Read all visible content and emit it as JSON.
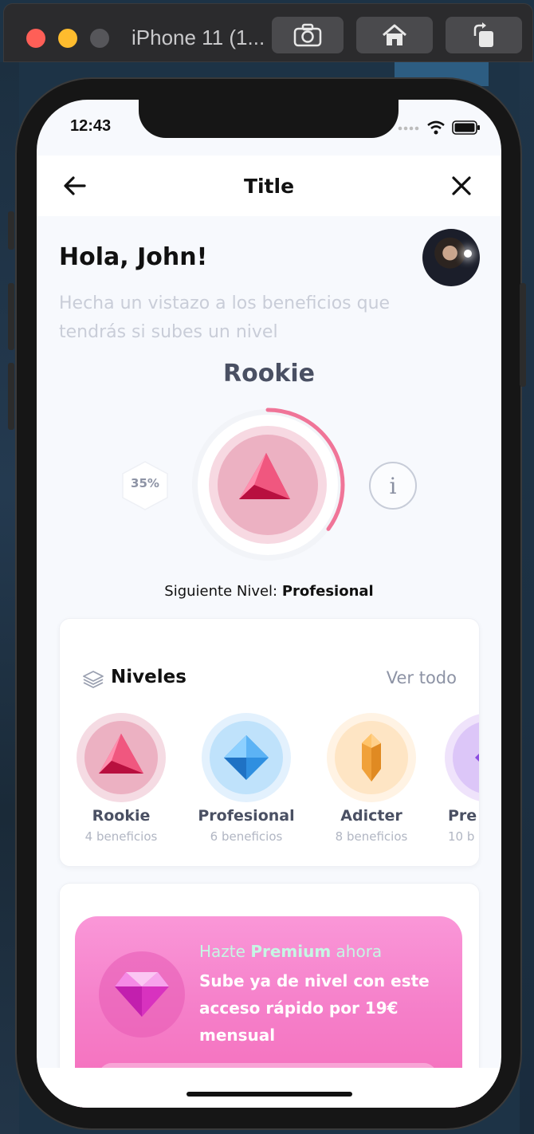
{
  "simulator": {
    "title": "iPhone 11 (1...",
    "buttons": [
      "screenshot",
      "home",
      "rotate"
    ]
  },
  "status": {
    "time": "12:43"
  },
  "nav": {
    "title": "Title"
  },
  "greeting": "Hola, John!",
  "subtitle": "Hecha un vistazo a los beneficios que tendrás si subes un nivel",
  "level": {
    "current": "Rookie",
    "progress_label": "35%",
    "progress": 0.35,
    "next_prefix": "Siguiente Nivel:",
    "next_name": "Profesional",
    "info_symbol": "i"
  },
  "levels_section": {
    "title": "Niveles",
    "see_all": "Ver todo",
    "items": [
      {
        "name": "Rookie",
        "benefits": "4 beneficios",
        "icon": "triangle-gem-icon",
        "color": "#e81e5a"
      },
      {
        "name": "Profesional",
        "benefits": "6 beneficios",
        "icon": "diamond-gem-icon",
        "color": "#2f8fe0"
      },
      {
        "name": "Adicter",
        "benefits": "8 beneficios",
        "icon": "crystal-gem-icon",
        "color": "#f0a13a"
      },
      {
        "name": "Pre",
        "benefits": "10 b",
        "icon": "purple-gem-icon",
        "color": "#8a4be0"
      }
    ]
  },
  "premium": {
    "prefix": "Hazte",
    "highlight": "Premium",
    "suffix": "ahora",
    "description": "Sube ya de nivel con este acceso rápido por 19€ mensual"
  },
  "colors": {
    "accent_pink": "#f07598",
    "premium_gradient_top": "#fa97d8",
    "premium_gradient_bottom": "#f56ab8",
    "mint": "#c6f7e4"
  }
}
